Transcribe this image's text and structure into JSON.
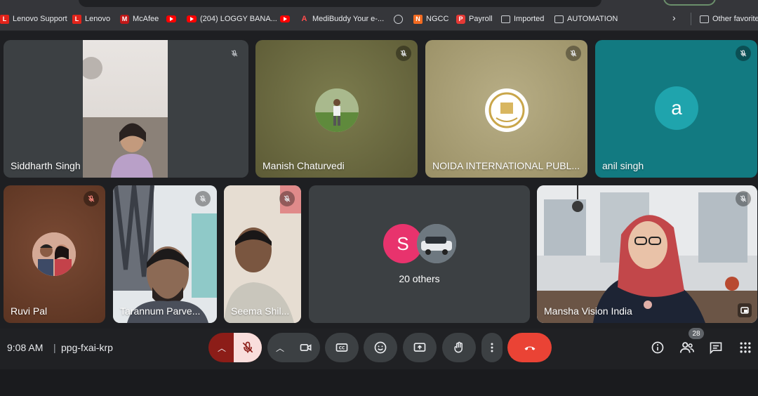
{
  "bookmarks": [
    {
      "label": "Lenovo Support",
      "icon": "lenovo-icon"
    },
    {
      "label": "Lenovo",
      "icon": "lenovo-icon"
    },
    {
      "label": "McAfee",
      "icon": "mcafee-icon"
    },
    {
      "label": "",
      "icon": "youtube-icon"
    },
    {
      "label": "(204) LOGGY BANA...",
      "icon": "youtube-icon"
    },
    {
      "label": "",
      "icon": "youtube-icon"
    },
    {
      "label": "MediBuddy Your e-...",
      "icon": "medibuddy-icon"
    },
    {
      "label": "",
      "icon": "globe-icon"
    },
    {
      "label": "NGCC",
      "icon": "ngcc-icon"
    },
    {
      "label": "Payroll",
      "icon": "payroll-icon"
    },
    {
      "label": "Imported",
      "icon": "folder-icon"
    },
    {
      "label": "AUTOMATION",
      "icon": "folder-icon"
    }
  ],
  "other_favorites": "Other favorites",
  "participants": [
    {
      "name": "Siddharth Singh",
      "muted": true
    },
    {
      "name": "Manish Chaturvedi",
      "muted": true
    },
    {
      "name": "NOIDA INTERNATIONAL PUBL...",
      "muted": true
    },
    {
      "name": "anil singh",
      "muted": true,
      "avatar_letter": "a"
    },
    {
      "name": "Ruvi Pal",
      "muted": true
    },
    {
      "name": "Tarannum Parve...",
      "muted": true
    },
    {
      "name": "Seema Shil...",
      "muted": true
    },
    {
      "name": "Mansha Vision India",
      "muted": true
    }
  ],
  "others_tile": {
    "avatar_letter": "S",
    "label": "20 others"
  },
  "meeting": {
    "time": "9:08 AM",
    "separator": "|",
    "code": "ppg-fxai-krp"
  },
  "people_count": "28",
  "colors": {
    "end_call": "#ea4335",
    "mic_off_bg": "#f9dedc",
    "others_avatar": "#e8336d",
    "anil_tile": "#127a81"
  }
}
